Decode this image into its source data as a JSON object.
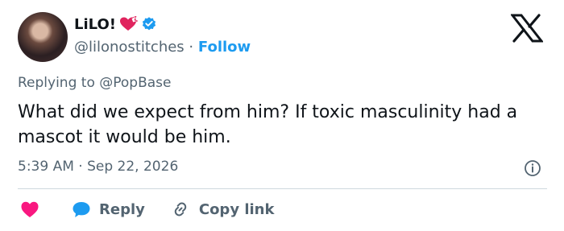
{
  "tweet": {
    "display_name": "LiLO!",
    "handle": "@lilonostitches",
    "separator": "·",
    "follow_label": "Follow",
    "replying_prefix": "Replying to",
    "replying_to": "@PopBase",
    "text": "What did we expect from him? If toxic masculinity had a mascot it would be him.",
    "time": "5:39 AM",
    "date": "Sep 22, 2026"
  },
  "actions": {
    "reply_label": "Reply",
    "copy_link_label": "Copy link"
  },
  "icons": {
    "verified": "verified-badge-icon",
    "emoji": "heart-with-ribbon-emoji",
    "logo": "x-logo-icon",
    "info": "info-icon",
    "like": "heart-icon",
    "reply": "speech-bubble-icon",
    "link": "link-icon"
  },
  "colors": {
    "accent": "#1d9bf0",
    "like": "#f91880",
    "muted": "#536471",
    "text": "#0f1419",
    "divider": "#cfd9de"
  }
}
